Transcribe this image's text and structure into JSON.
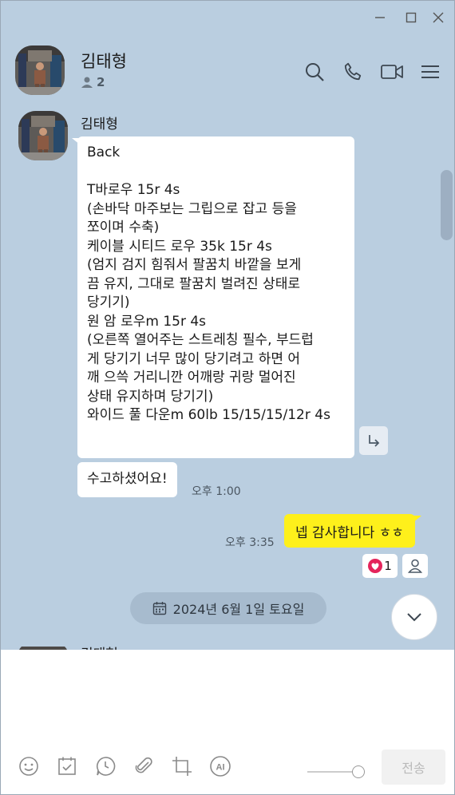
{
  "header": {
    "title": "김태형",
    "member_count": "2"
  },
  "messages": {
    "sender": "김태형",
    "long_message_lines": [
      "Back",
      "",
      "T바로우 15r 4s",
      "(손바닥 마주보는 그립으로 잡고 등을",
      "쪼이며 수축)",
      "케이블 시티드 로우 35k 15r 4s",
      "(엄지 검지 힘줘서 팔꿈치 바깥을 보게",
      "끔 유지, 그대로 팔꿈치 벌려진 상태로",
      "당기기)",
      "원 암 로우m 15r 4s",
      "(오른쪽 열어주는 스트레칭 필수, 부드럽",
      "게 당기기 너무 많이 당기려고 하면 어",
      "깨 으쓱 거리니깐 어깨랑 귀랑 멀어진",
      "상태 유지하며 당기기)",
      "와이드 풀 다운m 60lb 15/15/15/12r 4s"
    ],
    "short_message": "수고하셨어요!",
    "short_time": "오후 1:00",
    "my_message": "넵 감사합니다 ㅎㅎ",
    "my_time": "오후 3:35",
    "reaction_count": "1",
    "date_separator": "2024년 6월 1일 토요일",
    "next_sender_peek": "김태형"
  },
  "composer": {
    "placeholder": "",
    "send_label": "전송",
    "tools": [
      "emoji-icon",
      "calendar-check-icon",
      "clock-icon",
      "attachment-icon",
      "crop-icon",
      "ai-icon"
    ],
    "ai_label": "AI"
  },
  "colors": {
    "background": "#bacee0",
    "my_bubble": "#fef01b",
    "heart": "#e4245b"
  }
}
